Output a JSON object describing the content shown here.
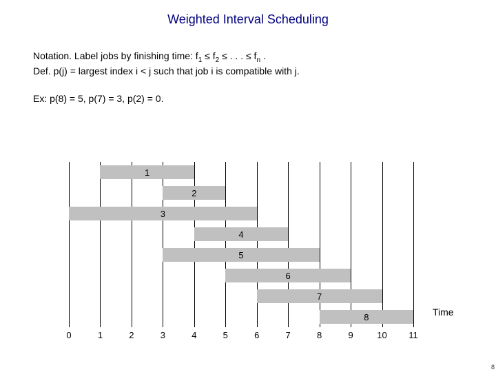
{
  "title": "Weighted Interval Scheduling",
  "notation_prefix": "Notation.",
  "notation_text": "  Label jobs by finishing time:  f",
  "notation_mid1": " ≤ f",
  "notation_mid2": " ≤ . . . ≤ f",
  "notation_end": " .",
  "sub1": "1",
  "sub2": "2",
  "subn": "n",
  "def_prefix": "Def.",
  "def_text": "  p(j) = largest index i < j such that job i is compatible with j.",
  "example": "Ex:  p(8) = 5, p(7) = 3, p(2) = 0.",
  "time_label": "Time",
  "page_number": "8",
  "chart_data": {
    "type": "bar",
    "xlabel": "Time",
    "ylabel": "",
    "xlim": [
      0,
      11
    ],
    "ticks": [
      "0",
      "1",
      "2",
      "3",
      "4",
      "5",
      "6",
      "7",
      "8",
      "9",
      "10",
      "11"
    ],
    "intervals": [
      {
        "label": "1",
        "start": 1,
        "end": 4
      },
      {
        "label": "2",
        "start": 3,
        "end": 5
      },
      {
        "label": "3",
        "start": 0,
        "end": 6
      },
      {
        "label": "4",
        "start": 4,
        "end": 7
      },
      {
        "label": "5",
        "start": 3,
        "end": 8
      },
      {
        "label": "6",
        "start": 5,
        "end": 9
      },
      {
        "label": "7",
        "start": 6,
        "end": 10
      },
      {
        "label": "8",
        "start": 8,
        "end": 11
      }
    ]
  }
}
